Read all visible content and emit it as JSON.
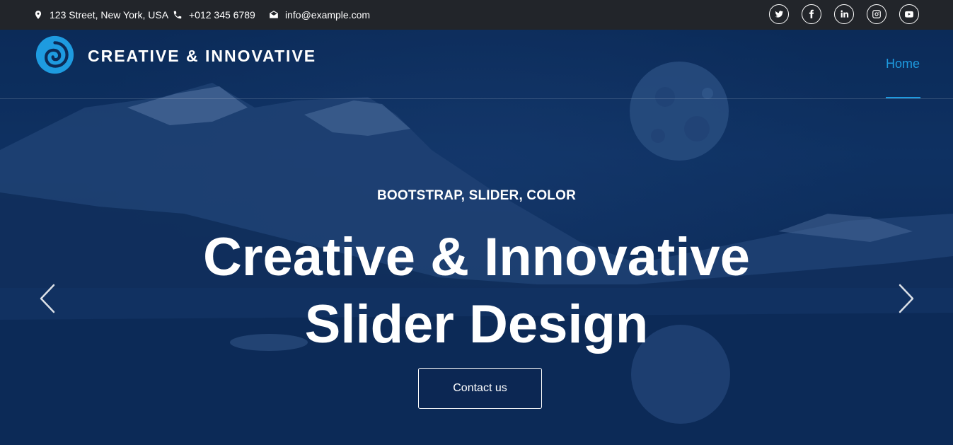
{
  "topbar": {
    "address": "123 Street, New York, USA",
    "phone": "+012 345 6789",
    "email": "info@example.com",
    "icons": {
      "address": "map-pin-icon",
      "phone": "phone-icon",
      "email": "envelope-icon"
    },
    "social": [
      "twitter-icon",
      "facebook-icon",
      "linkedin-icon",
      "instagram-icon",
      "youtube-icon"
    ]
  },
  "navbar": {
    "brand": "CREATIVE & INNOVATIVE",
    "logo_icon": "spiral-logo-icon",
    "nav_items": [
      {
        "label": "Home",
        "active": true
      }
    ],
    "accent_color": "#1e9be0"
  },
  "slide": {
    "subtitle": "BOOTSTRAP, SLIDER, COLOR",
    "headline_line1": "Creative & Innovative",
    "headline_line2": "Slider Design",
    "cta_label": "Contact us",
    "prev_icon": "chevron-left-icon",
    "next_icon": "chevron-right-icon"
  },
  "colors": {
    "topbar_bg": "#22252a",
    "hero_overlay": "#0b2a55",
    "text": "#ffffff"
  }
}
